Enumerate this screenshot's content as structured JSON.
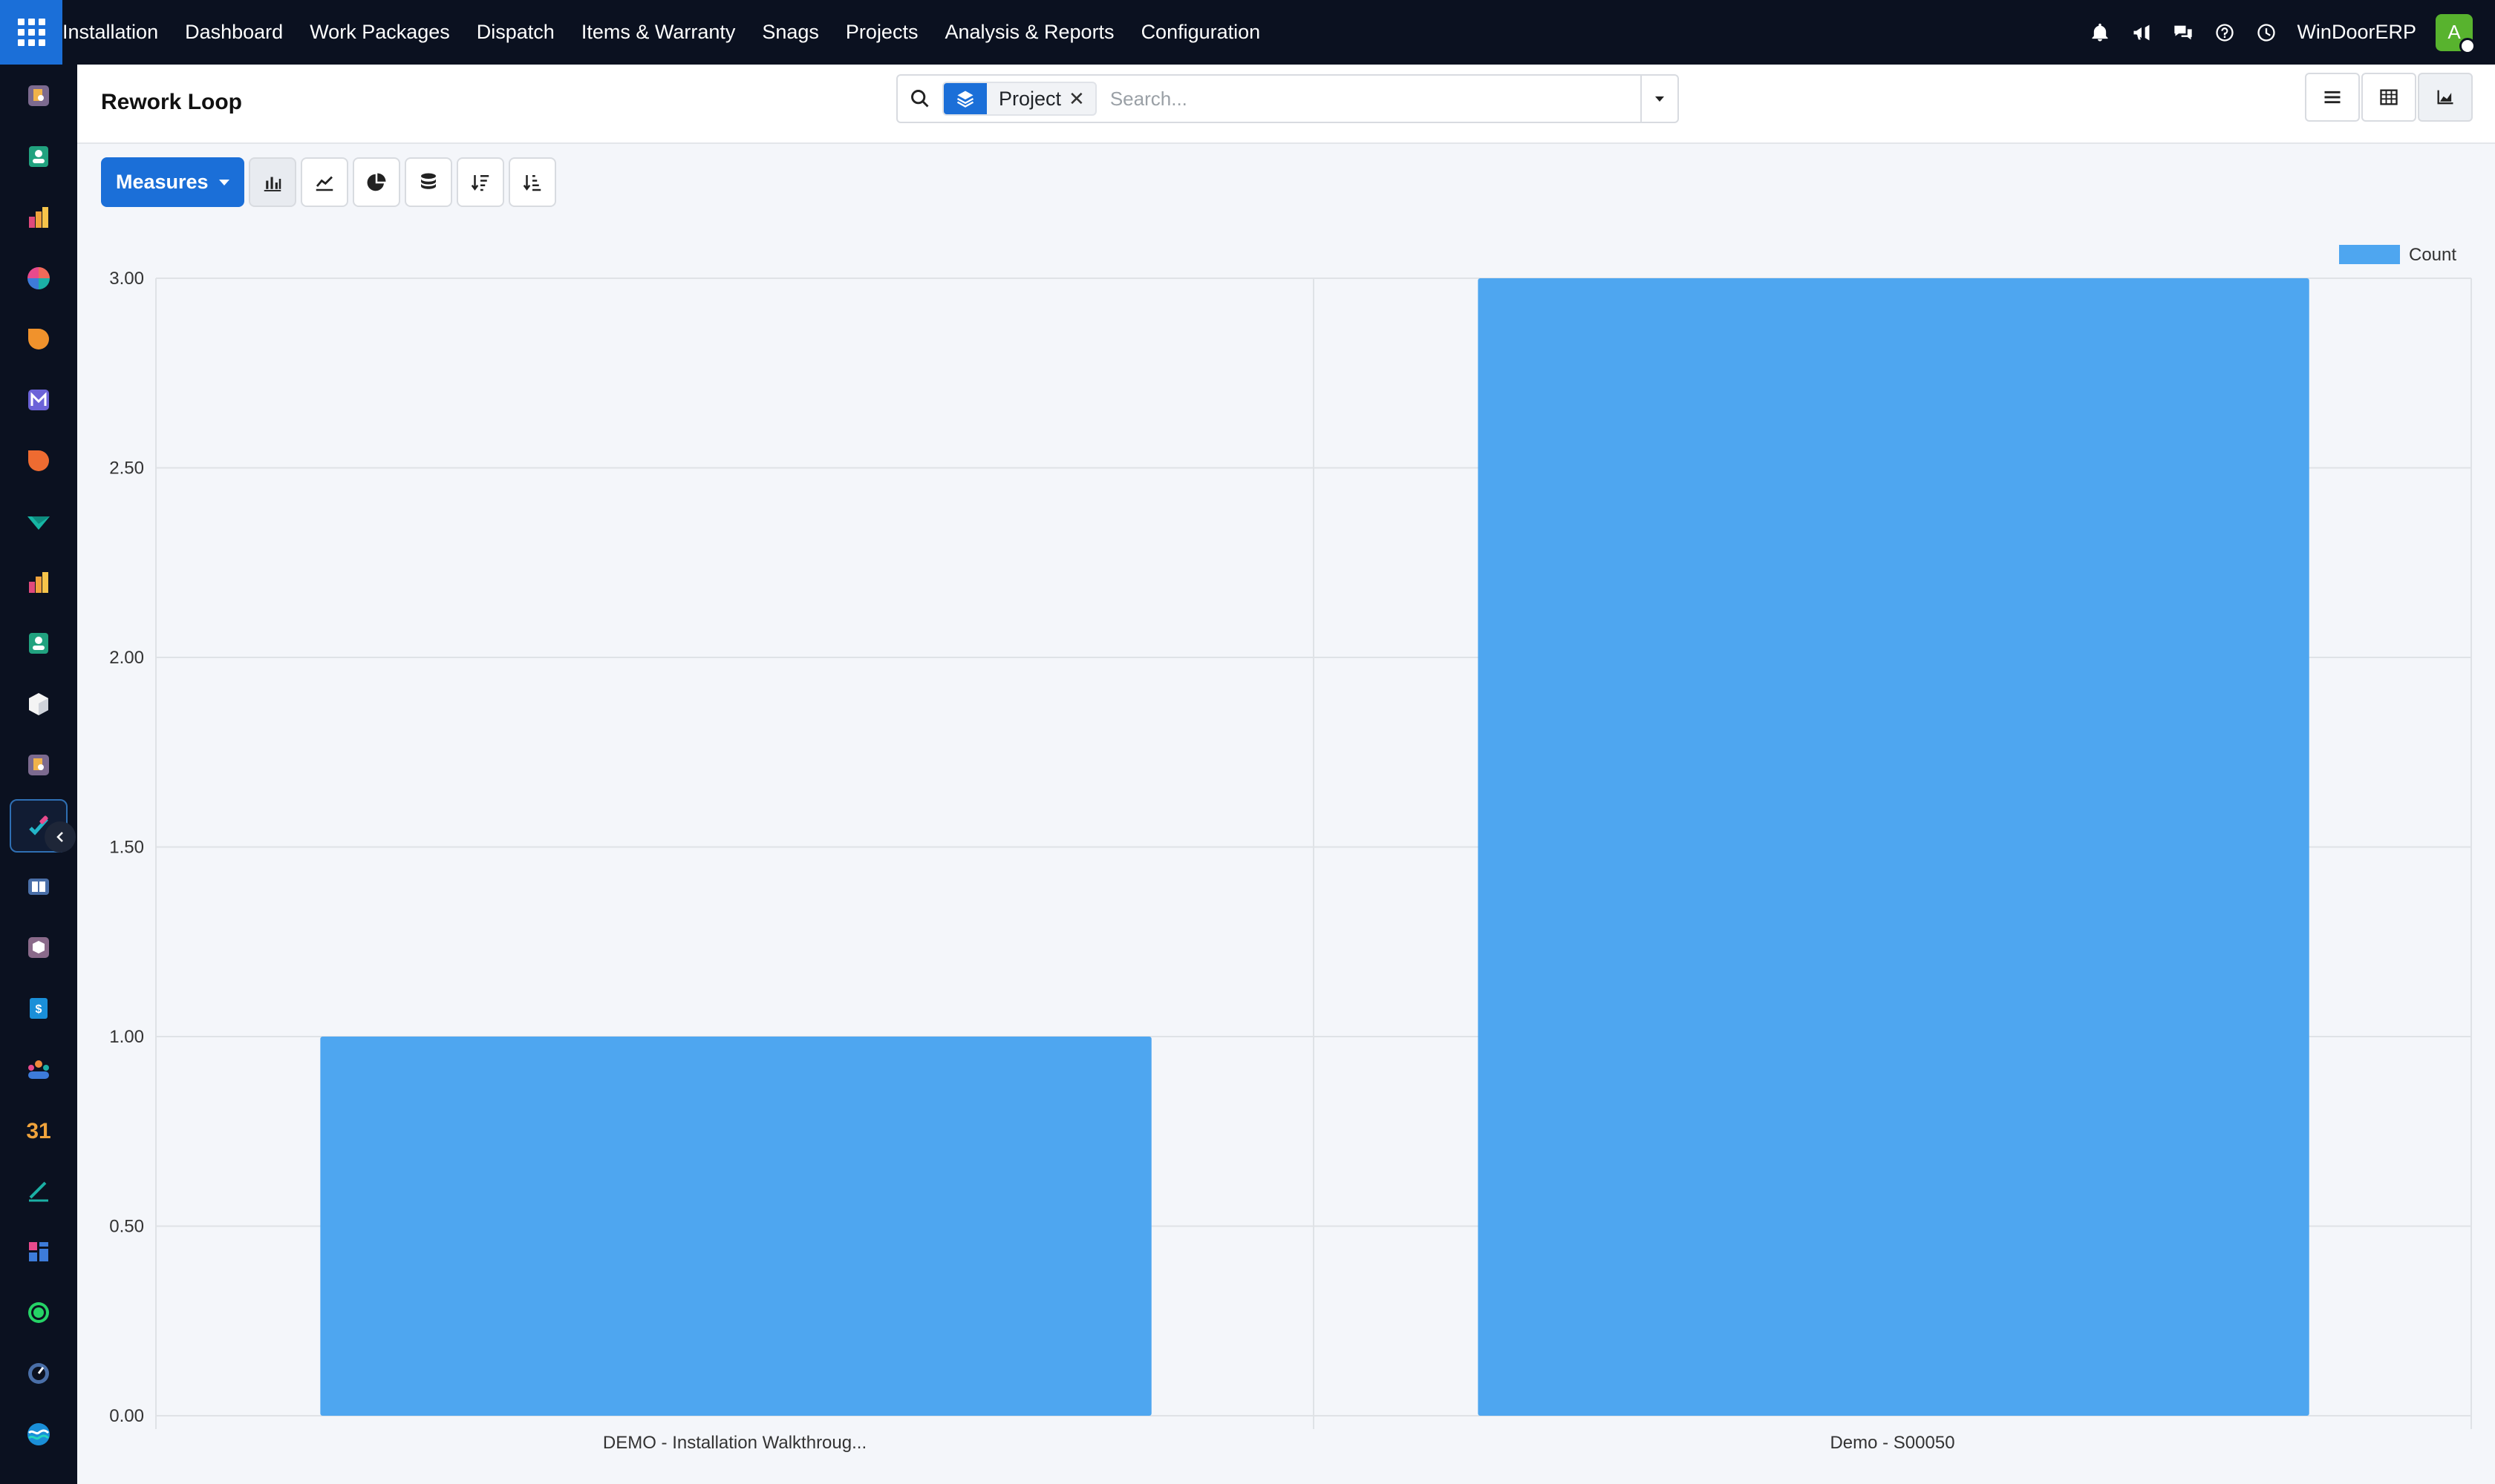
{
  "navbar": {
    "app_name": "Installation",
    "menu": [
      "Dashboard",
      "Work Packages",
      "Dispatch",
      "Items & Warranty",
      "Snags",
      "Projects",
      "Analysis & Reports",
      "Configuration"
    ],
    "company": "WinDoorERP",
    "avatar_initial": "A",
    "icons": [
      "bell-icon",
      "megaphone-icon",
      "chat-icon",
      "help-icon",
      "clock-icon"
    ]
  },
  "sidebar": {
    "apps": [
      "app-1",
      "app-2",
      "app-3",
      "app-4",
      "app-5",
      "app-6",
      "app-7",
      "app-8",
      "app-9",
      "app-10",
      "app-11",
      "app-12",
      "app-installation",
      "app-14",
      "app-15",
      "app-16",
      "app-17",
      "app-calendar",
      "app-19",
      "app-20",
      "app-whatsapp",
      "app-22",
      "app-23"
    ],
    "calendar_label": "31"
  },
  "control": {
    "title": "Rework Loop",
    "facet_label": "Project",
    "search_placeholder": "Search..."
  },
  "toolbar": {
    "measures_label": "Measures"
  },
  "colors": {
    "bar": "#4ea6f0",
    "accent": "#1b6fd8"
  },
  "chart_data": {
    "type": "bar",
    "categories": [
      "DEMO - Installation Walkthroug...",
      "Demo - S00050"
    ],
    "series": [
      {
        "name": "Count",
        "values": [
          1,
          3
        ]
      }
    ],
    "ylim": [
      0,
      3
    ],
    "yticks": [
      "0.00",
      "0.50",
      "1.00",
      "1.50",
      "2.00",
      "2.50",
      "3.00"
    ],
    "grid": true,
    "legend": "top-right"
  }
}
